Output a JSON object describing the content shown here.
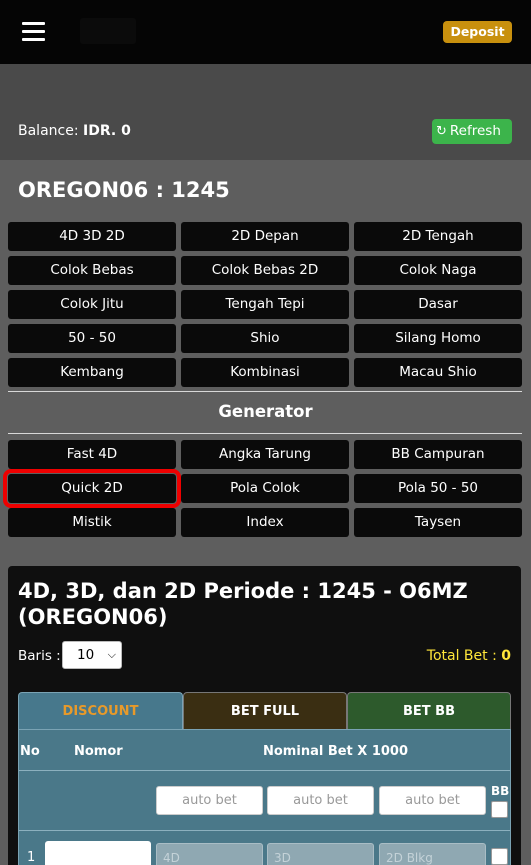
{
  "header": {
    "deposit_label": "Deposit"
  },
  "balance": {
    "label": "Balance:",
    "value": "IDR. 0",
    "refresh_label": "Refresh"
  },
  "market": {
    "title": "OREGON06 : 1245"
  },
  "game_types": [
    "4D 3D 2D",
    "2D Depan",
    "2D Tengah",
    "Colok Bebas",
    "Colok Bebas 2D",
    "Colok Naga",
    "Colok Jitu",
    "Tengah Tepi",
    "Dasar",
    "50 - 50",
    "Shio",
    "Silang Homo",
    "Kembang",
    "Kombinasi",
    "Macau Shio"
  ],
  "generator": {
    "title": "Generator",
    "items": [
      "Fast 4D",
      "Angka Tarung",
      "BB Campuran",
      "Quick 2D",
      "Pola Colok",
      "Pola 50 - 50",
      "Mistik",
      "Index",
      "Taysen"
    ],
    "highlighted": "Quick 2D"
  },
  "bet_card": {
    "title": "4D, 3D, dan 2D Periode : 1245 - O6MZ (OREGON06)",
    "baris_label": "Baris :",
    "baris_value": "10",
    "total_bet_label": "Total Bet :",
    "total_bet_value": "0",
    "tabs": [
      "DISCOUNT",
      "BET FULL",
      "BET BB"
    ],
    "columns": {
      "no": "No",
      "nomor": "Nomor",
      "nominal": "Nominal Bet X 1000",
      "bb": "BB"
    },
    "auto_bet_placeholder": "auto bet",
    "rows": [
      {
        "no": "1",
        "placeholders": [
          "4D",
          "3D",
          "2D Blkg"
        ]
      }
    ]
  },
  "colors": {
    "deposit": "#c8900e",
    "refresh": "#3cb44b",
    "highlight": "#e00000",
    "total_bet": "#ffe63a",
    "discount_tab_text": "#e89a2a"
  }
}
